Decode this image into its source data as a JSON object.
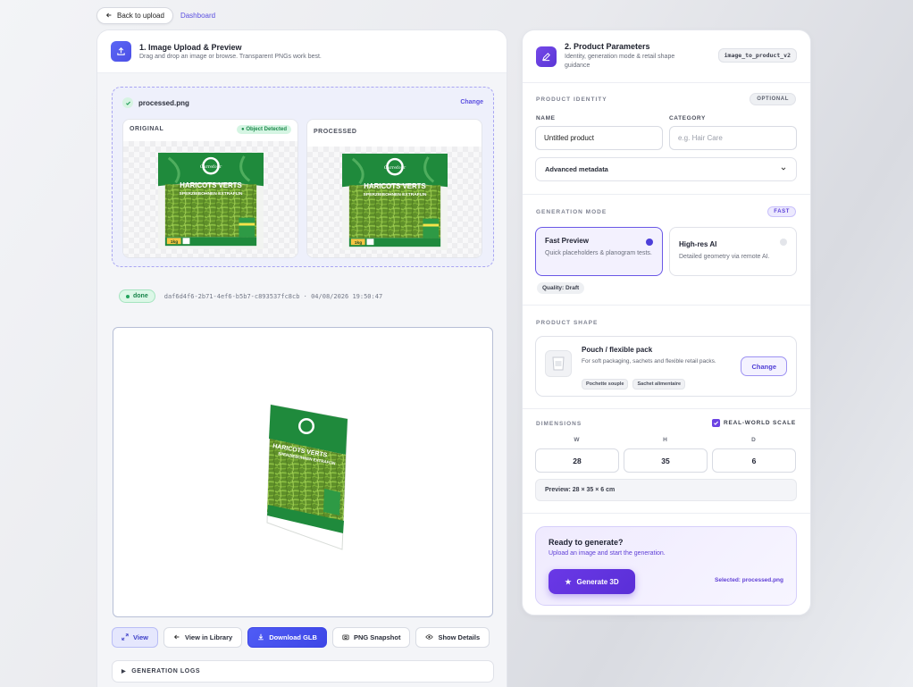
{
  "nav": {
    "back_label": "Back to upload",
    "dashboard_label": "Dashboard"
  },
  "left": {
    "title": "1. Image Upload & Preview",
    "subtitle": "Drag and drop an image or browse. Transparent PNGs work best.",
    "file_name": "processed.png",
    "change_label": "Change",
    "original_label": "ORIGINAL",
    "detected_label": "Object Detected",
    "processed_label": "PROCESSED",
    "status": "done",
    "job_info": "daf6d4f6-2b71-4ef6-b5b7-c893537fc8cb · 04/08/2026 19:50:47",
    "actions": {
      "view": "View",
      "library": "View in Library",
      "download": "Download GLB",
      "snapshot": "PNG Snapshot",
      "details": "Show Details"
    },
    "logs_label": "GENERATION LOGS"
  },
  "product_label": {
    "logo": "Carrefour",
    "line1": "HARICOTS VERTS",
    "line2": "EXTRA-FINS",
    "line3": "SPERZIEBOHNEN EXTRAFIJN",
    "weight": "1kg"
  },
  "right": {
    "title": "2. Product Parameters",
    "subtitle": "Identity, generation mode & retail shape guidance",
    "code_chip": "image_to_product_v2",
    "identity": {
      "section": "PRODUCT IDENTITY",
      "chip": "OPTIONAL",
      "name_label": "NAME",
      "name_value": "Untitled product",
      "category_label": "CATEGORY",
      "category_placeholder": "e.g. Hair Care",
      "advanced_label": "Advanced metadata"
    },
    "mode": {
      "section": "GENERATION MODE",
      "chip": "FAST",
      "fast_title": "Fast Preview",
      "fast_desc": "Quick placeholders & planogram tests.",
      "hires_title": "High-res AI",
      "hires_desc": "Detailed geometry via remote AI.",
      "quality": "Quality: Draft"
    },
    "shape": {
      "section": "PRODUCT SHAPE",
      "title": "Pouch / flexible pack",
      "desc": "For soft packaging, sachets and flexible retail packs.",
      "tags": [
        "Pochette souple",
        "Sachet alimentaire"
      ],
      "change_label": "Change"
    },
    "dimensions": {
      "section": "DIMENSIONS",
      "scale_label": "REAL-WORLD SCALE",
      "w_label": "W",
      "h_label": "H",
      "d_label": "D",
      "w": "28",
      "h": "35",
      "d": "6",
      "preview": "Preview: 28 × 35 × 6 cm"
    },
    "ready": {
      "title": "Ready to generate?",
      "subtitle": "Upload an image and start the generation.",
      "button": "Generate 3D",
      "selected": "Selected: processed.png"
    }
  },
  "colors": {
    "accent": "#4f5cf5",
    "violet": "#6a38e6",
    "success": "#22a45d",
    "bag_green": "#1f8a3c"
  }
}
